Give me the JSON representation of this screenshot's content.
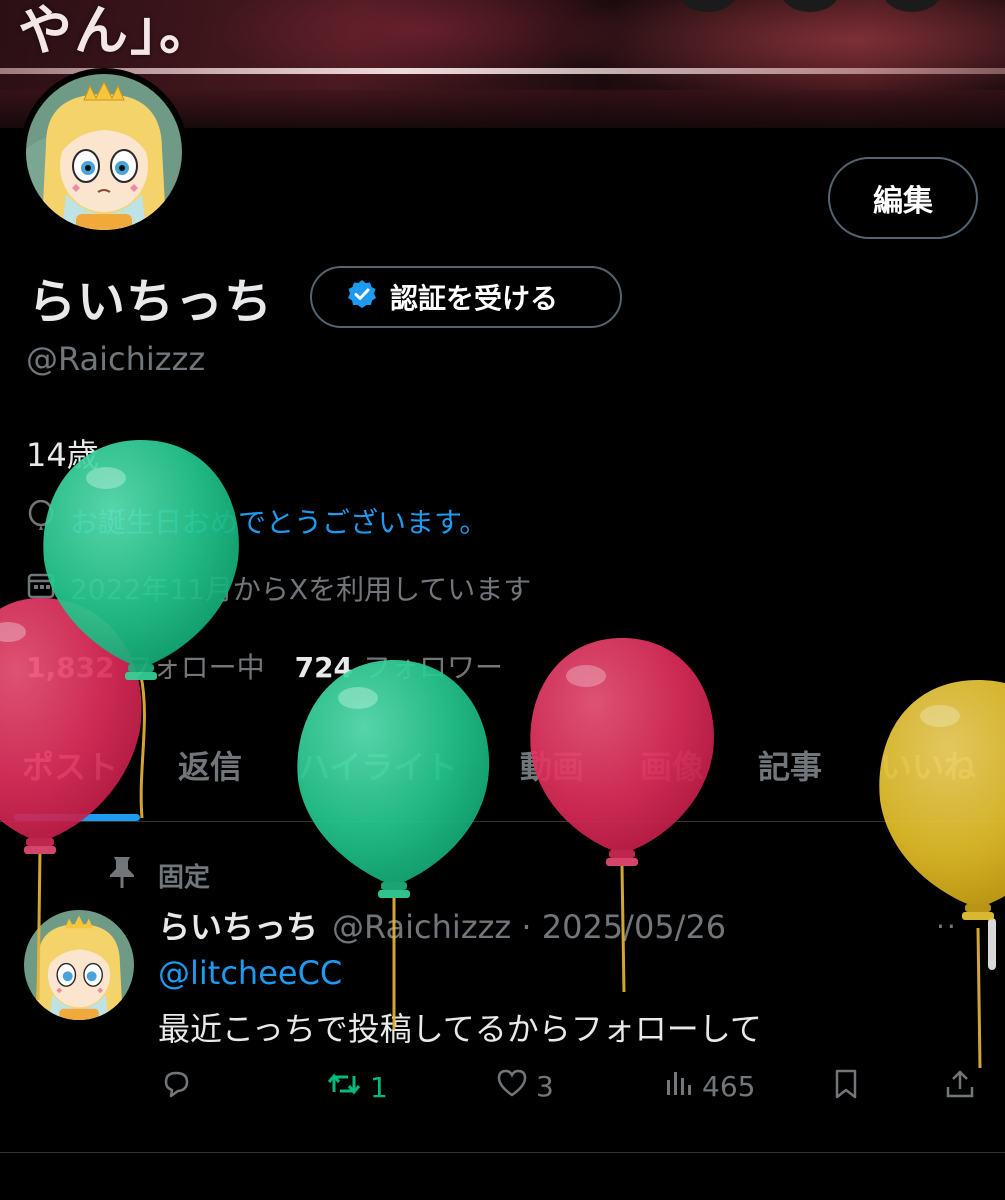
{
  "banner": {
    "text": "やん」。"
  },
  "profile": {
    "edit_label": "編集",
    "display_name": "らいちっち",
    "verify_label": "認証を受ける",
    "handle": "@Raichizzz",
    "bio": "14歳",
    "birthday_text": "お誕生日おめでとうございます。",
    "joined_text": "2022年11月からXを利用しています",
    "following_count": "1,832",
    "following_label": "フォロー中",
    "followers_count": "724",
    "followers_label": "フォロワー"
  },
  "tabs": [
    {
      "label": "ポスト"
    },
    {
      "label": "返信"
    },
    {
      "label": "ハイライト"
    },
    {
      "label": "動画"
    },
    {
      "label": "画像"
    },
    {
      "label": "記事"
    },
    {
      "label": "いいね"
    }
  ],
  "pinned_post": {
    "pinned_label": "固定",
    "author_name": "らいちっち",
    "author_meta": "@Raichizzz · 2025/05/26",
    "mention": "@litcheeCC",
    "text": "最近こっちで投稿してるからフォローして",
    "reposts": "1",
    "likes": "3",
    "views": "465"
  },
  "colors": {
    "accent": "#1d9bf0",
    "repost": "#00ba7c",
    "muted": "#71767b",
    "balloon_green": "#2fd19a",
    "balloon_red": "#e0305e",
    "balloon_yellow": "#e8c227"
  },
  "icons": [
    "verified-badge-icon",
    "balloon-icon",
    "calendar-icon",
    "pin-icon",
    "reply-icon",
    "repost-icon",
    "heart-icon",
    "views-icon",
    "bookmark-icon",
    "share-icon",
    "more-icon"
  ]
}
